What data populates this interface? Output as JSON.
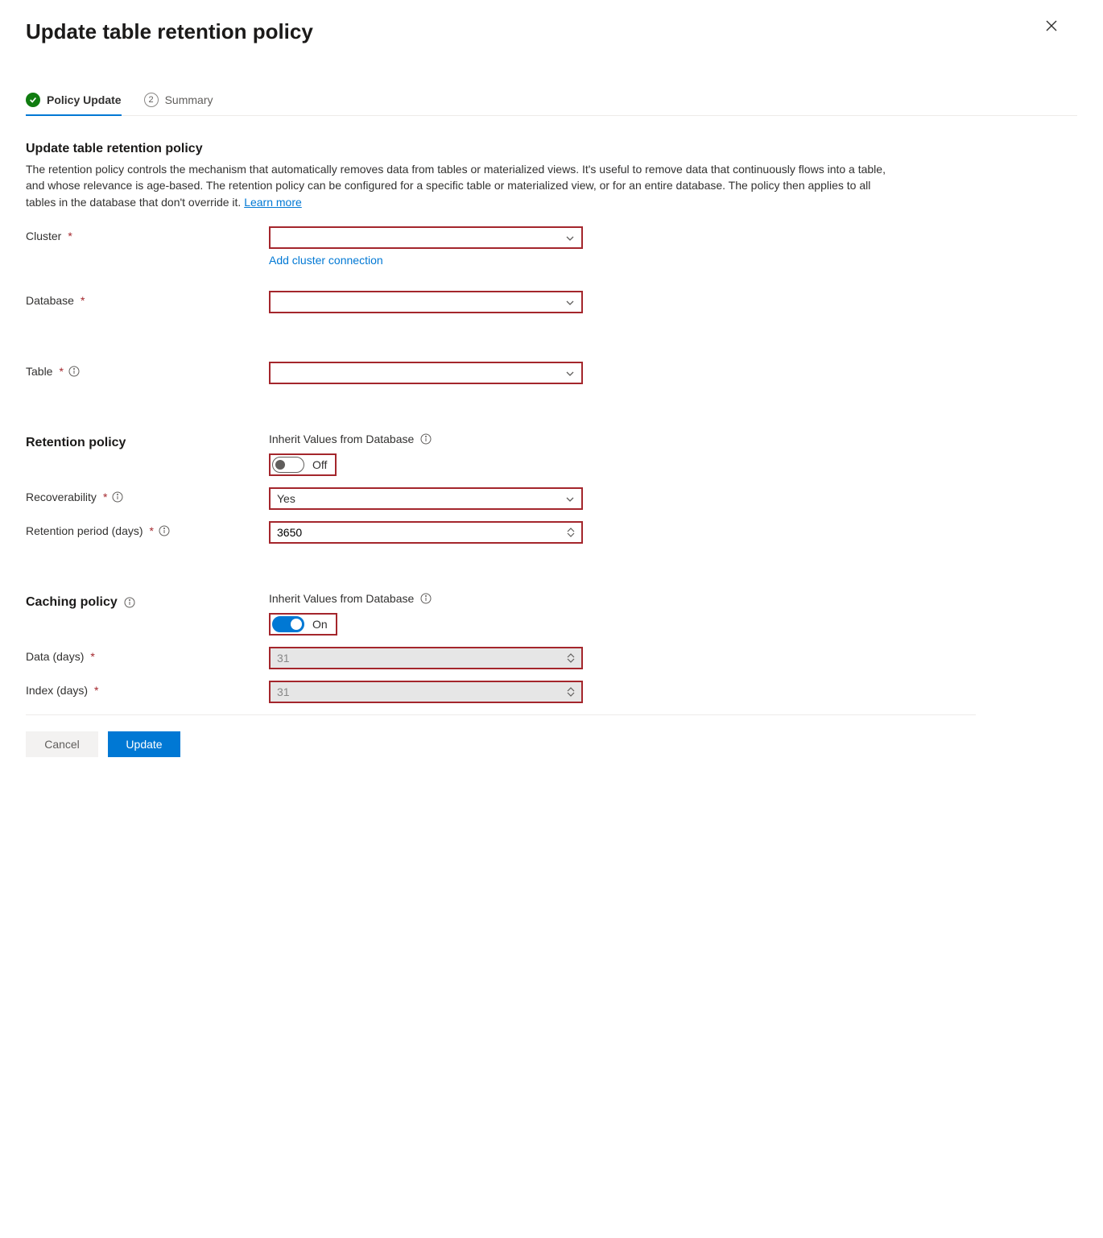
{
  "header": {
    "title": "Update table retention policy"
  },
  "tabs": {
    "policy_update": "Policy Update",
    "summary_num": "2",
    "summary": "Summary"
  },
  "section": {
    "title": "Update table retention policy",
    "description": "The retention policy controls the mechanism that automatically removes data from tables or materialized views. It's useful to remove data that continuously flows into a table, and whose relevance is age-based. The retention policy can be configured for a specific table or materialized view, or for an entire database. The policy then applies to all tables in the database that don't override it. ",
    "learn_more": "Learn more"
  },
  "fields": {
    "cluster_label": "Cluster",
    "add_cluster_link": "Add cluster connection",
    "database_label": "Database",
    "table_label": "Table",
    "retention_heading": "Retention policy",
    "inherit_label": "Inherit Values from Database",
    "inherit_retention_state": "Off",
    "recoverability_label": "Recoverability",
    "recoverability_value": "Yes",
    "retention_period_label": "Retention period (days)",
    "retention_period_value": "3650",
    "caching_heading": "Caching policy",
    "inherit_caching_state": "On",
    "data_days_label": "Data (days)",
    "data_days_value": "31",
    "index_days_label": "Index (days)",
    "index_days_value": "31"
  },
  "footer": {
    "cancel": "Cancel",
    "update": "Update"
  }
}
